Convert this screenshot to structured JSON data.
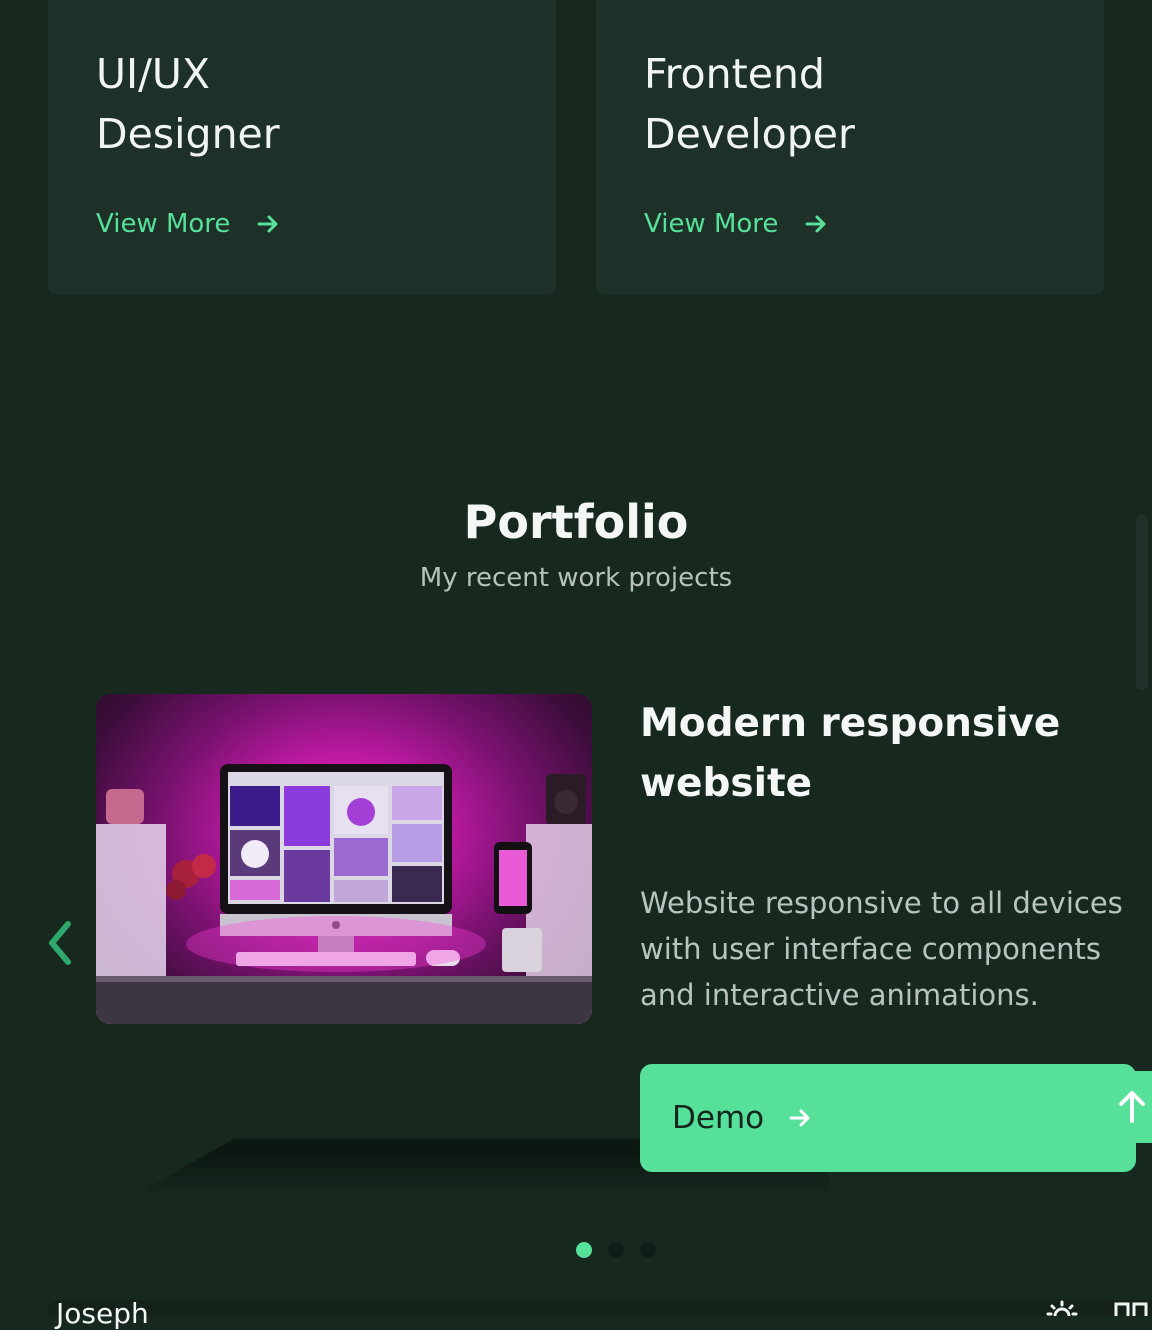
{
  "services": [
    {
      "title_line1": "UI/UX",
      "title_line2": "Designer",
      "link_label": "View More"
    },
    {
      "title_line1": "Frontend",
      "title_line2": "Developer",
      "link_label": "View More"
    }
  ],
  "portfolio": {
    "title": "Portfolio",
    "subtitle": "My recent work projects",
    "project": {
      "title": "Modern responsive website",
      "description": "Website responsive to all devices with user interface components and interactive animations.",
      "button_label": "Demo"
    },
    "pagination": {
      "total": 3,
      "active": 1
    }
  },
  "header": {
    "brand": "Joseph"
  },
  "icons": {
    "arrow": "arrow-right-icon",
    "prev": "chevron-left-icon",
    "scroll_up": "arrow-up-icon",
    "theme": "sun-icon",
    "menu": "grid-icon"
  },
  "colors": {
    "accent": "#56e09a",
    "background": "#17291f",
    "card": "#1e3128"
  }
}
